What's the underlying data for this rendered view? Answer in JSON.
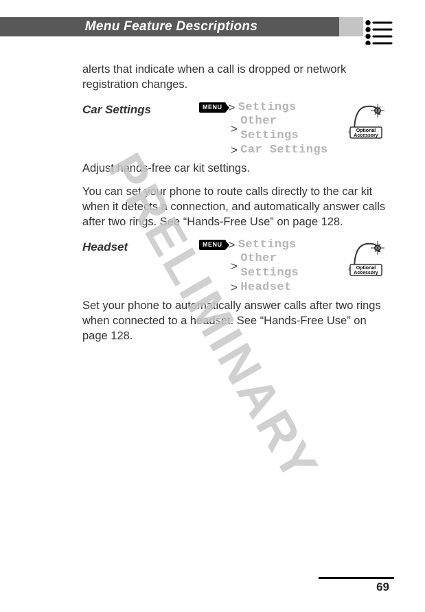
{
  "header": {
    "title": "Menu Feature Descriptions"
  },
  "watermark": "PRELIMINARY",
  "intro_paragraph": "alerts that indicate when a call is dropped or network registration changes.",
  "menu_key_label": "MENU",
  "accessory_label": {
    "line1": "Optional",
    "line2": "Accessory"
  },
  "sections": [
    {
      "title": "Car Settings",
      "nav": [
        "Settings",
        "Other Settings",
        "Car Settings"
      ],
      "body": [
        "Adjust hands-free car kit settings.",
        "You can set your phone to route calls directly to the car kit when it detects a connection, and automatically answer calls after two rings. See “Hands-Free Use” on page 128."
      ]
    },
    {
      "title": "Headset",
      "nav": [
        "Settings",
        "Other Settings",
        "Headset"
      ],
      "body": [
        "Set your phone to automatically answer calls after two rings when connected to a headset. See “Hands-Free Use” on page 128."
      ]
    }
  ],
  "page_number": "69"
}
